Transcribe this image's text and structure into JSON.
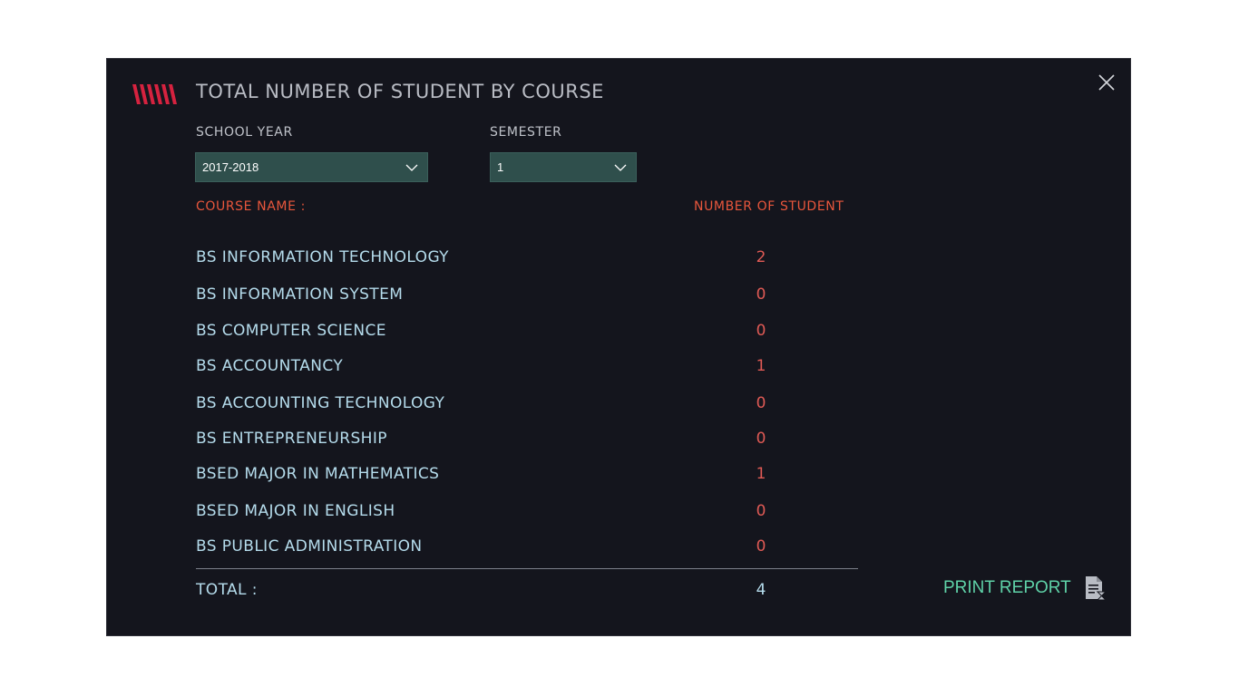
{
  "dialog": {
    "title": "TOTAL NUMBER OF STUDENT BY COURSE",
    "close_icon": "close-icon",
    "logo_icon": "stripes-logo-icon"
  },
  "filters": {
    "school_year": {
      "label": "SCHOOL YEAR",
      "value": "2017-2018"
    },
    "semester": {
      "label": "SEMESTER",
      "value": "1"
    }
  },
  "table": {
    "course_header": "COURSE NAME :",
    "count_header": "NUMBER OF STUDENT",
    "rows": [
      {
        "name": "BS INFORMATION TECHNOLOGY",
        "count": "2"
      },
      {
        "name": "BS INFORMATION SYSTEM",
        "count": "0"
      },
      {
        "name": "BS COMPUTER SCIENCE",
        "count": "0"
      },
      {
        "name": "BS ACCOUNTANCY",
        "count": "1"
      },
      {
        "name": "BS ACCOUNTING TECHNOLOGY",
        "count": "0"
      },
      {
        "name": "BS ENTREPRENEURSHIP",
        "count": "0"
      },
      {
        "name": "BSED MAJOR IN MATHEMATICS",
        "count": "1"
      },
      {
        "name": "BSED MAJOR IN ENGLISH",
        "count": "0"
      },
      {
        "name": "BS PUBLIC ADMINISTRATION",
        "count": "0"
      }
    ],
    "total_label": "TOTAL :",
    "total_value": "4"
  },
  "actions": {
    "print_label": "PRINT REPORT",
    "print_icon": "report-document-icon"
  },
  "colors": {
    "background": "#14151d",
    "accent_red": "#e8563c",
    "count_red": "#e05a55",
    "course_text": "#b5dcec",
    "select_bg": "#2f4f4c",
    "print_green": "#5fd2a8",
    "logo_red": "#d6223f"
  }
}
